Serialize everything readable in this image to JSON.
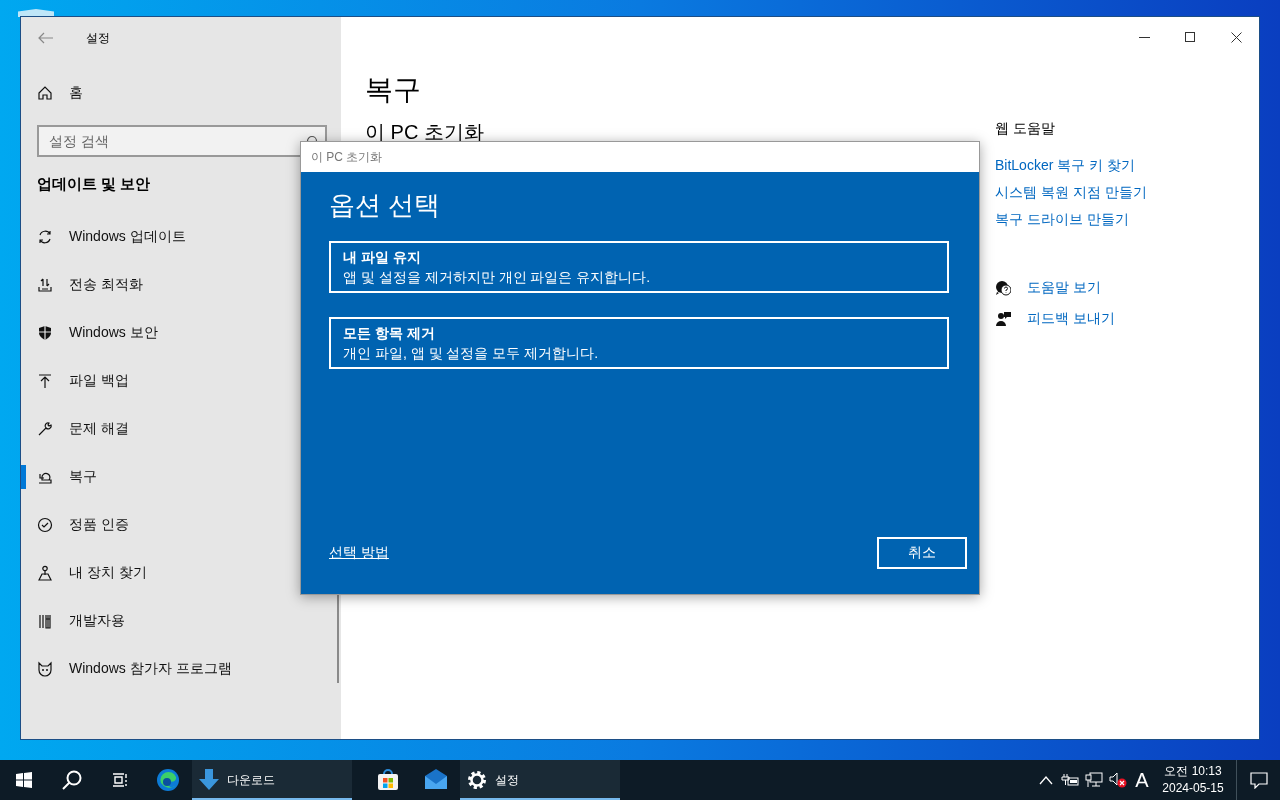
{
  "window": {
    "title": "설정"
  },
  "sidebar": {
    "home": "홈",
    "search": {
      "placeholder": "설정 검색"
    },
    "section": "업데이트 및 보안",
    "items": [
      {
        "label": "Windows 업데이트",
        "selected": false
      },
      {
        "label": "전송 최적화",
        "selected": false
      },
      {
        "label": "Windows 보안",
        "selected": false
      },
      {
        "label": "파일 백업",
        "selected": false
      },
      {
        "label": "문제 해결",
        "selected": false
      },
      {
        "label": "복구",
        "selected": true
      },
      {
        "label": "정품 인증",
        "selected": false
      },
      {
        "label": "내 장치 찾기",
        "selected": false
      },
      {
        "label": "개발자용",
        "selected": false
      },
      {
        "label": "Windows 참가자 프로그램",
        "selected": false
      }
    ]
  },
  "main": {
    "title": "복구",
    "section": "이 PC 초기화"
  },
  "help": {
    "title": "웹 도움말",
    "links": [
      "BitLocker 복구 키 찾기",
      "시스템 복원 지점 만들기",
      "복구 드라이브 만들기"
    ],
    "actions": [
      "도움말 보기",
      "피드백 보내기"
    ]
  },
  "dialog": {
    "title": "이 PC 초기화",
    "heading": "옵션 선택",
    "options": [
      {
        "title": "내 파일 유지",
        "description": "앱 및 설정을 제거하지만 개인 파일은 유지합니다."
      },
      {
        "title": "모든 항목 제거",
        "description": "개인 파일, 앱 및 설정을 모두 제거합니다."
      }
    ],
    "help_link": "선택 방법",
    "cancel": "취소"
  },
  "taskbar": {
    "apps": [
      {
        "kind": "edge",
        "running": false
      },
      {
        "kind": "download",
        "label": "다운로드",
        "running": true
      },
      {
        "kind": "store",
        "running": false
      },
      {
        "kind": "mail",
        "running": false
      },
      {
        "kind": "settings",
        "label": "설정",
        "running": true
      }
    ],
    "ime": "A",
    "time": "오전 10:13",
    "date": "2024-05-15"
  }
}
